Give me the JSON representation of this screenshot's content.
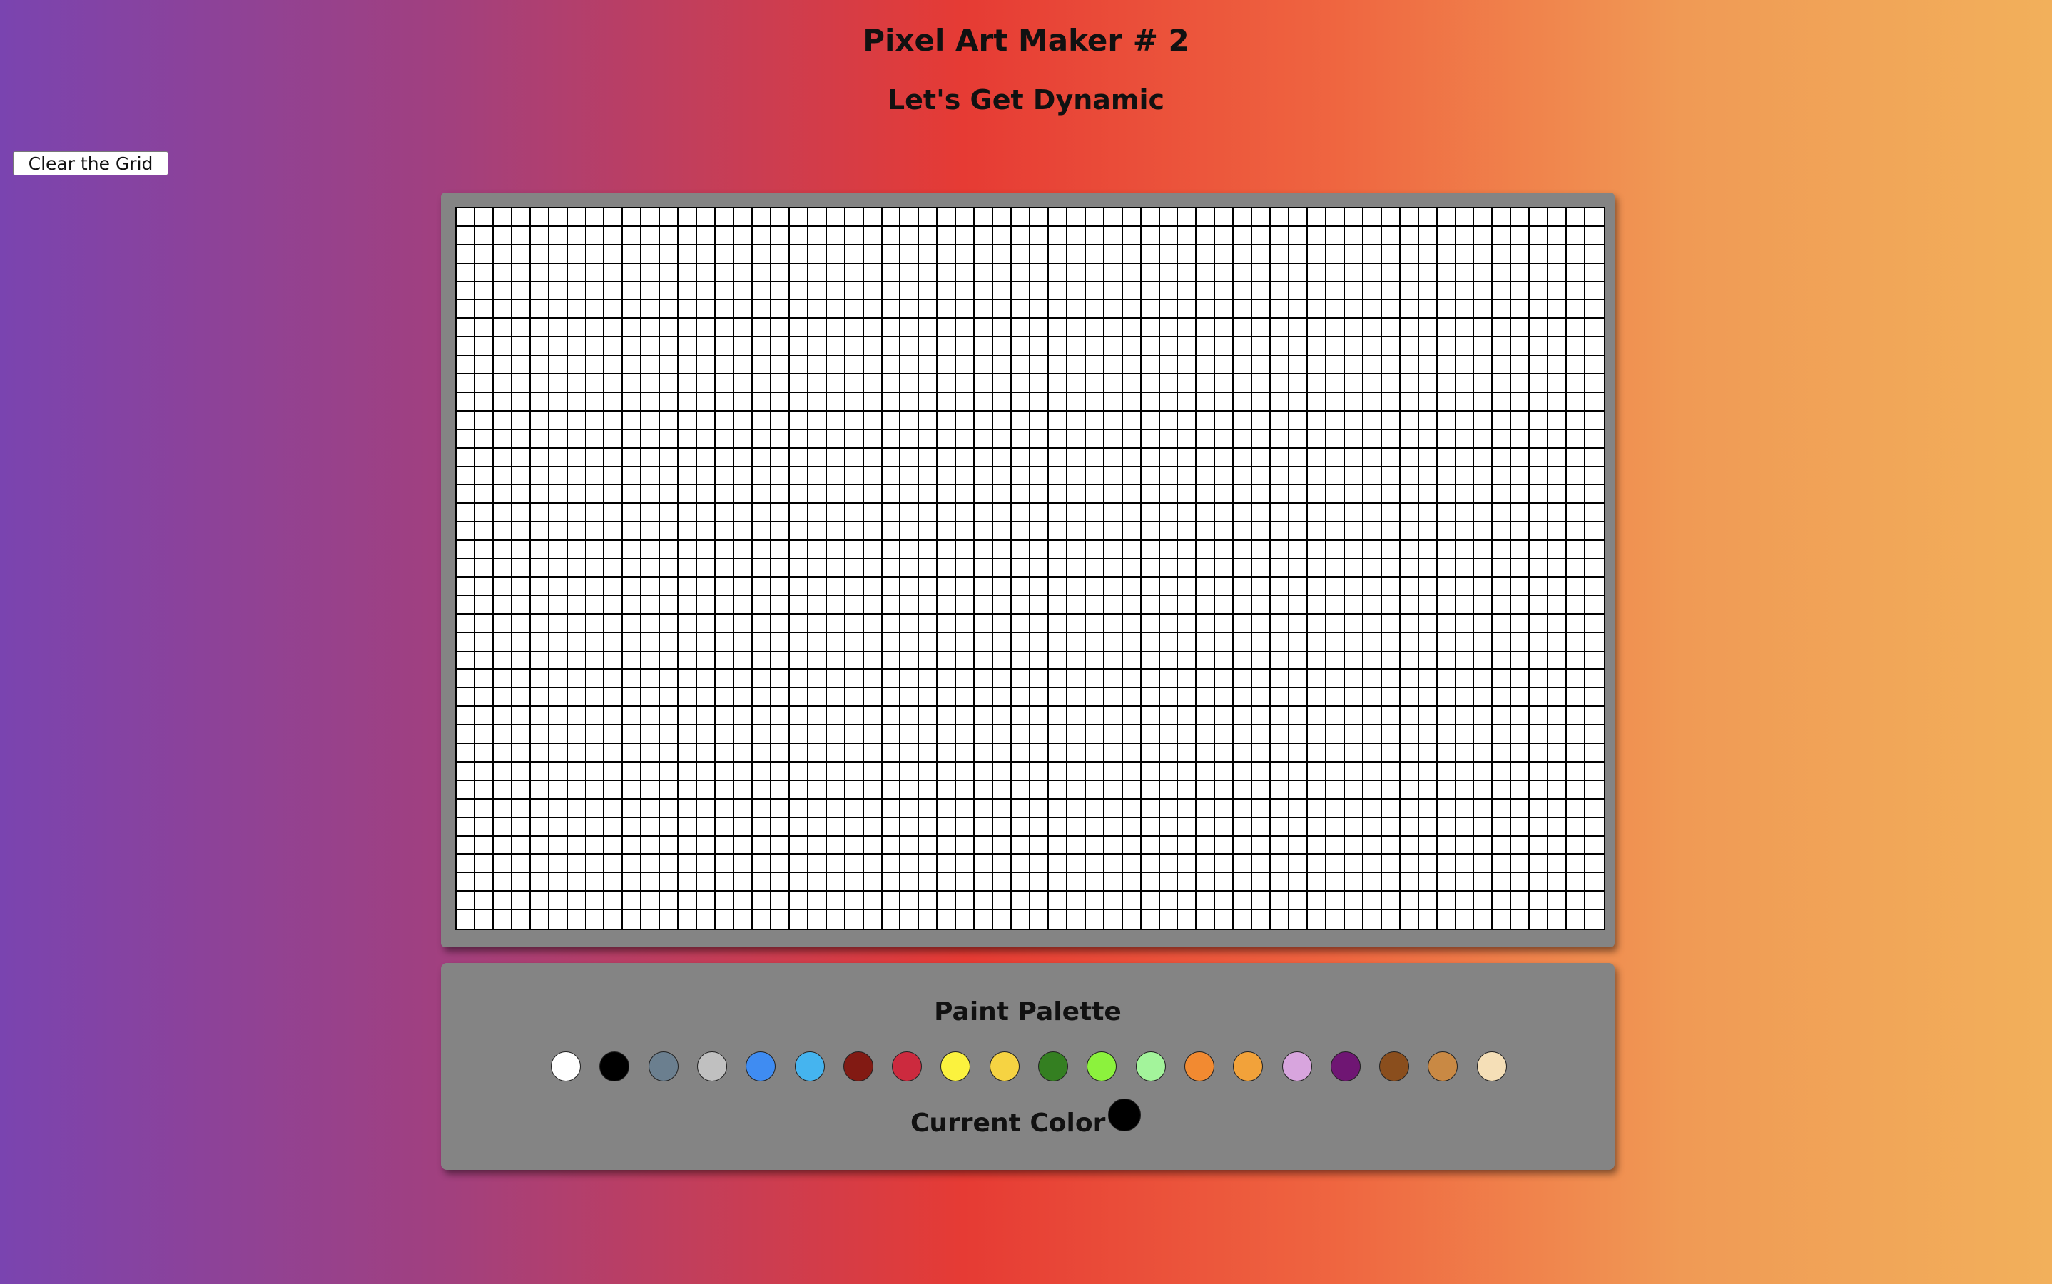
{
  "header": {
    "title": "Pixel Art Maker # 2",
    "subtitle": "Let's Get Dynamic"
  },
  "controls": {
    "clear_label": "Clear the Grid"
  },
  "grid": {
    "columns": 62,
    "rows": 39,
    "cell_color": "#ffffff",
    "line_color": "#000000"
  },
  "palette": {
    "title": "Paint Palette",
    "colors": [
      "#ffffff",
      "#000000",
      "#6b7f8f",
      "#c0c0c0",
      "#3f8cf2",
      "#45b4ef",
      "#821a13",
      "#cc2a3e",
      "#fbf23e",
      "#f6d342",
      "#347f21",
      "#8cf23d",
      "#a3f49b",
      "#f28a31",
      "#f2a23a",
      "#d8a5de",
      "#6f1673",
      "#8a4e1d",
      "#c98944",
      "#f5dfb7"
    ],
    "current_label": "Current Color",
    "current_color": "#000000"
  }
}
